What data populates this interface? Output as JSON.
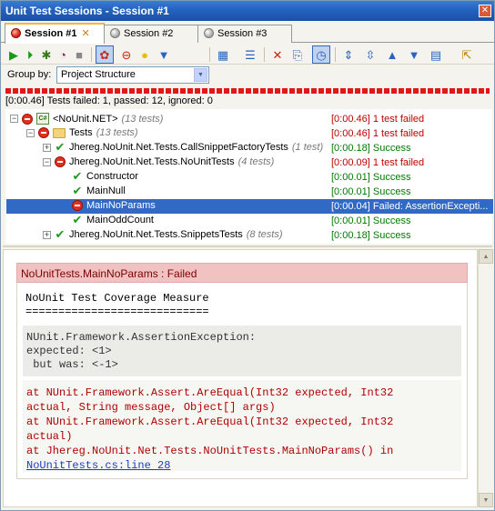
{
  "window": {
    "title": "Unit Test Sessions - Session #1"
  },
  "tabs": [
    {
      "label": "Session #1",
      "active": true
    },
    {
      "label": "Session #2",
      "active": false
    },
    {
      "label": "Session #3",
      "active": false
    }
  ],
  "toolbar": {
    "buttons": [
      "run-icon",
      "run-all-icon",
      "debug-icon",
      "profile-icon",
      "stop-icon",
      "show-all-icon",
      "failed-filter-icon",
      "ignored-filter-icon",
      "filter-icon",
      "group-icon",
      "order-icon",
      "remove-icon",
      "export-icon",
      "auto-run-icon",
      "expand-all-icon",
      "collapse-all-icon",
      "prev-failed-icon",
      "next-failed-icon",
      "layout-icon",
      "track-icon"
    ]
  },
  "groupby": {
    "label": "Group by:",
    "value": "Project Structure"
  },
  "summary": "[0:00.46] Tests failed: 1, passed: 12, ignored: 0",
  "tree": [
    {
      "name": "<NoUnit.NET>",
      "count": "(13 tests)",
      "status": "[0:00.46] 1 test failed"
    },
    {
      "name": "Tests",
      "count": "(13 tests)",
      "status": "[0:00.46] 1 test failed"
    },
    {
      "name": "Jhereg.NoUnit.Net.Tests.CallSnippetFactoryTests",
      "count": "(1 test)",
      "status": "[0:00.18] Success"
    },
    {
      "name": "Jhereg.NoUnit.Net.Tests.NoUnitTests",
      "count": "(4 tests)",
      "status": "[0:00.09] 1 test failed"
    },
    {
      "name": "Constructor",
      "count": "",
      "status": "[0:00.01] Success"
    },
    {
      "name": "MainNull",
      "count": "",
      "status": "[0:00.01] Success"
    },
    {
      "name": "MainNoParams",
      "count": "",
      "status": "[0:00.04] Failed: AssertionExcepti..."
    },
    {
      "name": "MainOddCount",
      "count": "",
      "status": "[0:00.01] Success"
    },
    {
      "name": "Jhereg.NoUnit.Net.Tests.SnippetsTests",
      "count": "(8 tests)",
      "status": "[0:00.18] Success"
    }
  ],
  "details": {
    "header": "NoUnitTests.MainNoParams : Failed",
    "heading_line1": "NoUnit Test Coverage Measure",
    "heading_line2": "============================",
    "assertion": "NUnit.Framework.AssertionException:\nexpected: <1>\n but was: <-1>",
    "stack": [
      "at NUnit.Framework.Assert.AreEqual(Int32 expected, Int32",
      "actual, String message, Object[] args)",
      "at NUnit.Framework.Assert.AreEqual(Int32 expected, Int32",
      "actual)",
      "at Jhereg.NoUnit.Net.Tests.NoUnitTests.MainNoParams() in"
    ],
    "source_link": "NoUnitTests.cs:line 28"
  }
}
